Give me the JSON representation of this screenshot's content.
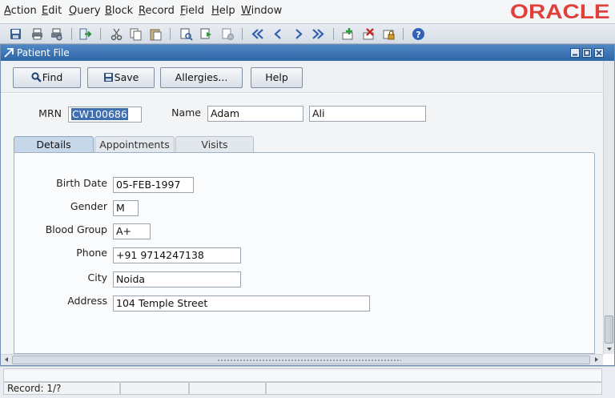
{
  "menu": [
    {
      "pre": "",
      "key": "A",
      "rest": "ction"
    },
    {
      "pre": "",
      "key": "E",
      "rest": "dit"
    },
    {
      "pre": "",
      "key": "Q",
      "rest": "uery"
    },
    {
      "pre": "",
      "key": "B",
      "rest": "lock"
    },
    {
      "pre": "",
      "key": "R",
      "rest": "ecord"
    },
    {
      "pre": "",
      "key": "F",
      "rest": "ield"
    },
    {
      "pre": "",
      "key": "H",
      "rest": "elp"
    },
    {
      "pre": "",
      "key": "W",
      "rest": "indow"
    }
  ],
  "brand": {
    "logo_text": "ORACLE",
    "color": "#e0403a"
  },
  "toolbar_icons": [
    "save-icon",
    "print-icon",
    "print-setup-icon",
    "exit-icon",
    "cut-icon",
    "copy-icon",
    "paste-icon",
    "enter-query-icon",
    "execute-query-icon",
    "cancel-query-icon",
    "first-record-icon",
    "previous-record-icon",
    "next-record-icon",
    "last-record-icon",
    "insert-record-icon",
    "delete-record-icon",
    "lock-record-icon",
    "help-icon"
  ],
  "window": {
    "title": "Patient File"
  },
  "buttons": {
    "find": "Find",
    "save": "Save",
    "allergies": "Allergies...",
    "help": "Help"
  },
  "header": {
    "mrn_label": "MRN",
    "mrn_value": "CW100686",
    "name_label": "Name",
    "first_name": "Adam",
    "last_name": "Ali"
  },
  "tabs": [
    {
      "label": "Details",
      "active": true
    },
    {
      "label": "Appointments",
      "active": false
    },
    {
      "label": "Visits",
      "active": false
    }
  ],
  "details": {
    "birth_date_label": "Birth Date",
    "birth_date": "05-FEB-1997",
    "gender_label": "Gender",
    "gender": "M",
    "blood_group_label": "Blood Group",
    "blood_group": "A+",
    "phone_label": "Phone",
    "phone": "+91 9714247138",
    "city_label": "City",
    "city": "Noida",
    "address_label": "Address",
    "address": "104 Temple Street"
  },
  "status": {
    "record": "Record: 1/?"
  }
}
